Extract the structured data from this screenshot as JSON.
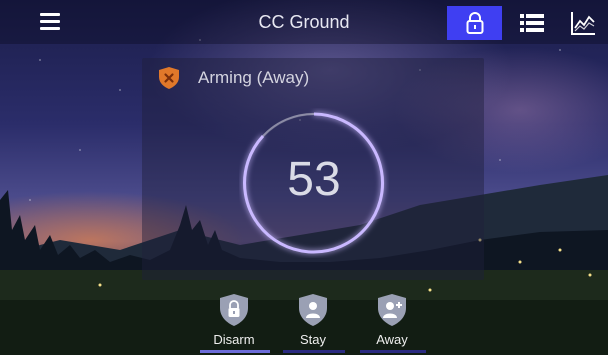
{
  "header": {
    "title": "CC Ground",
    "icons": {
      "menu": "hamburger-menu-icon",
      "security": "lock-icon",
      "list": "list-icon",
      "history": "line-chart-icon"
    },
    "active_color": "#3f3ff2"
  },
  "panel": {
    "status_icon": "shield-x-icon",
    "status_text": "Arming (Away)",
    "countdown": "53"
  },
  "actions": [
    {
      "label": "Disarm",
      "icon": "shield-lock-icon"
    },
    {
      "label": "Stay",
      "icon": "shield-person-icon"
    },
    {
      "label": "Away",
      "icon": "shield-person-add-icon"
    }
  ],
  "colors": {
    "ring": "#c9b8ff",
    "status_icon": "#e0782a"
  }
}
